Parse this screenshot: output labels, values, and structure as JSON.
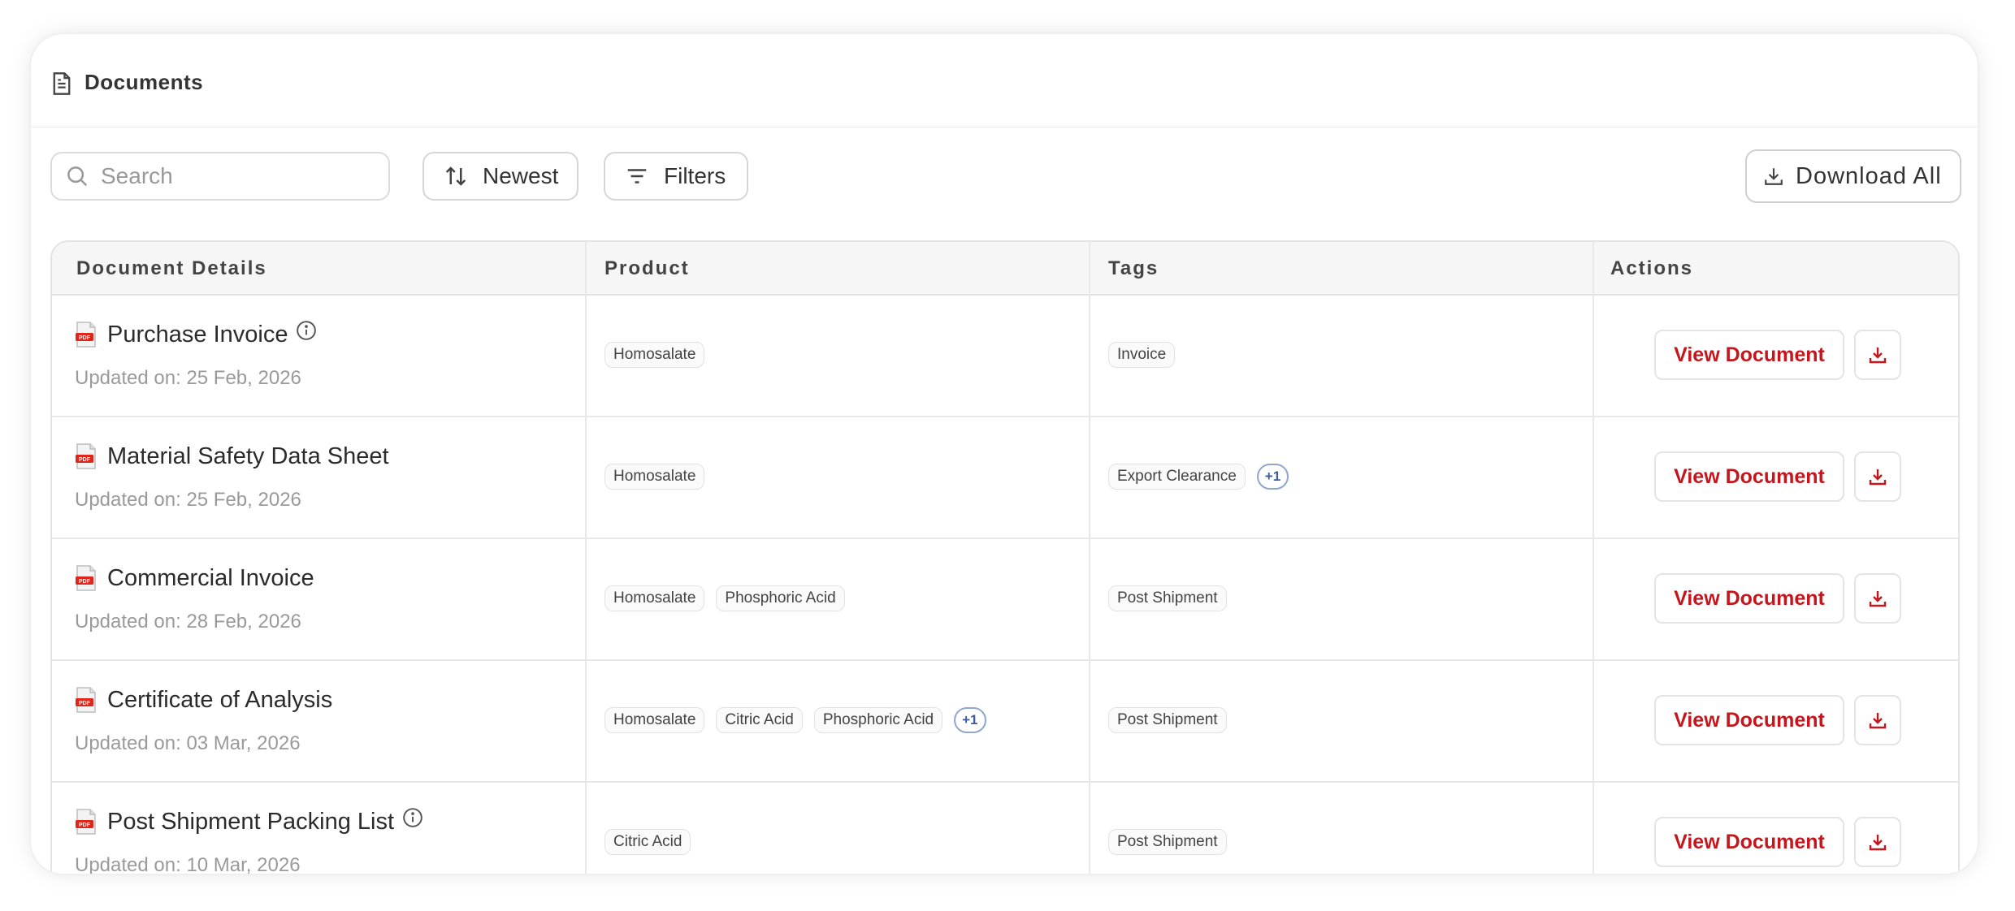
{
  "header": {
    "title": "Documents",
    "icon": "document-icon"
  },
  "toolbar": {
    "search_placeholder": "Search",
    "sort_label": "Newest",
    "filter_label": "Filters",
    "download_all_label": "Download All"
  },
  "table": {
    "columns": [
      "Document Details",
      "Product",
      "Tags",
      "Actions"
    ],
    "rows": [
      {
        "title": "Purchase Invoice",
        "has_info": true,
        "updated": "Updated on: 25 Feb, 2026",
        "products": [
          "Homosalate"
        ],
        "products_more": "",
        "tags": [
          "Invoice"
        ],
        "tags_more": "",
        "view_label": "View Document"
      },
      {
        "title": "Material Safety Data Sheet",
        "has_info": false,
        "updated": "Updated on: 25 Feb, 2026",
        "products": [
          "Homosalate"
        ],
        "products_more": "",
        "tags": [
          "Export Clearance"
        ],
        "tags_more": "+1",
        "view_label": "View Document"
      },
      {
        "title": "Commercial Invoice",
        "has_info": false,
        "updated": "Updated on: 28 Feb, 2026",
        "products": [
          "Homosalate",
          "Phosphoric Acid"
        ],
        "products_more": "",
        "tags": [
          "Post Shipment"
        ],
        "tags_more": "",
        "view_label": "View Document"
      },
      {
        "title": "Certificate of Analysis",
        "has_info": false,
        "updated": "Updated on: 03 Mar, 2026",
        "products": [
          "Homosalate",
          "Citric Acid",
          "Phosphoric Acid"
        ],
        "products_more": "+1",
        "tags": [
          "Post Shipment"
        ],
        "tags_more": "",
        "view_label": "View Document"
      },
      {
        "title": "Post Shipment Packing List",
        "has_info": true,
        "updated": "Updated on: 10 Mar, 2026",
        "products": [
          "Citric Acid"
        ],
        "products_more": "",
        "tags": [
          "Post Shipment"
        ],
        "tags_more": "",
        "view_label": "View Document"
      }
    ]
  },
  "colors": {
    "accent_red": "#c4161c",
    "more_chip_blue": "#3d5c99"
  }
}
